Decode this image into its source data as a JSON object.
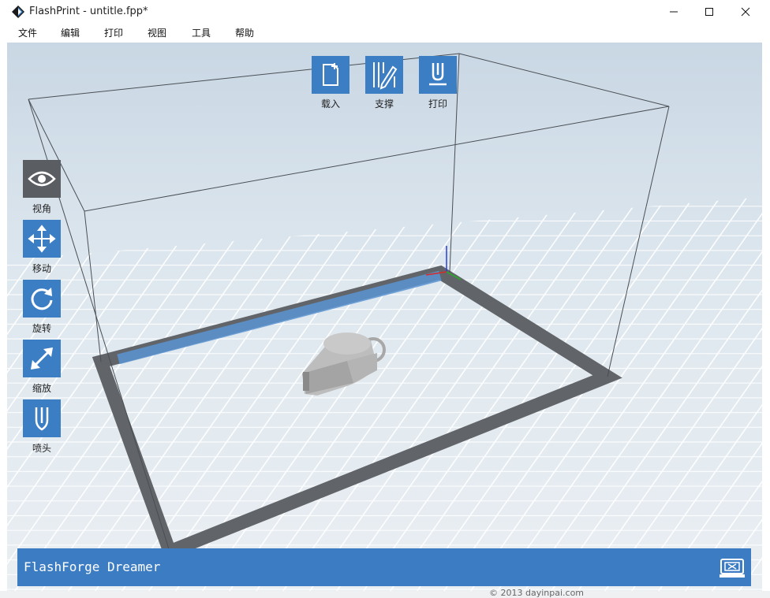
{
  "window": {
    "title": "FlashPrint - untitle.fpp*"
  },
  "menu": [
    "文件",
    "编辑",
    "打印",
    "视图",
    "工具",
    "帮助"
  ],
  "top_toolbar": [
    {
      "label": "载入",
      "icon": "load-file-icon"
    },
    {
      "label": "支撑",
      "icon": "support-icon"
    },
    {
      "label": "打印",
      "icon": "print-icon"
    }
  ],
  "side_toolbar": [
    {
      "label": "视角",
      "icon": "eye-icon",
      "active": true
    },
    {
      "label": "移动",
      "icon": "move-arrows-icon",
      "active": false
    },
    {
      "label": "旋转",
      "icon": "rotate-icon",
      "active": false
    },
    {
      "label": "缩放",
      "icon": "scale-icon",
      "active": false
    },
    {
      "label": "喷头",
      "icon": "nozzle-icon",
      "active": false
    }
  ],
  "status": {
    "printer_name": "FlashForge Dreamer"
  },
  "background_fragments": [
    "© 2013 dayinpai.com"
  ],
  "colors": {
    "accent": "#3c7ec4",
    "active_tool": "#5a5d61",
    "status_bar": "#3c7cc2",
    "grid_bg": "#dde6ee"
  }
}
